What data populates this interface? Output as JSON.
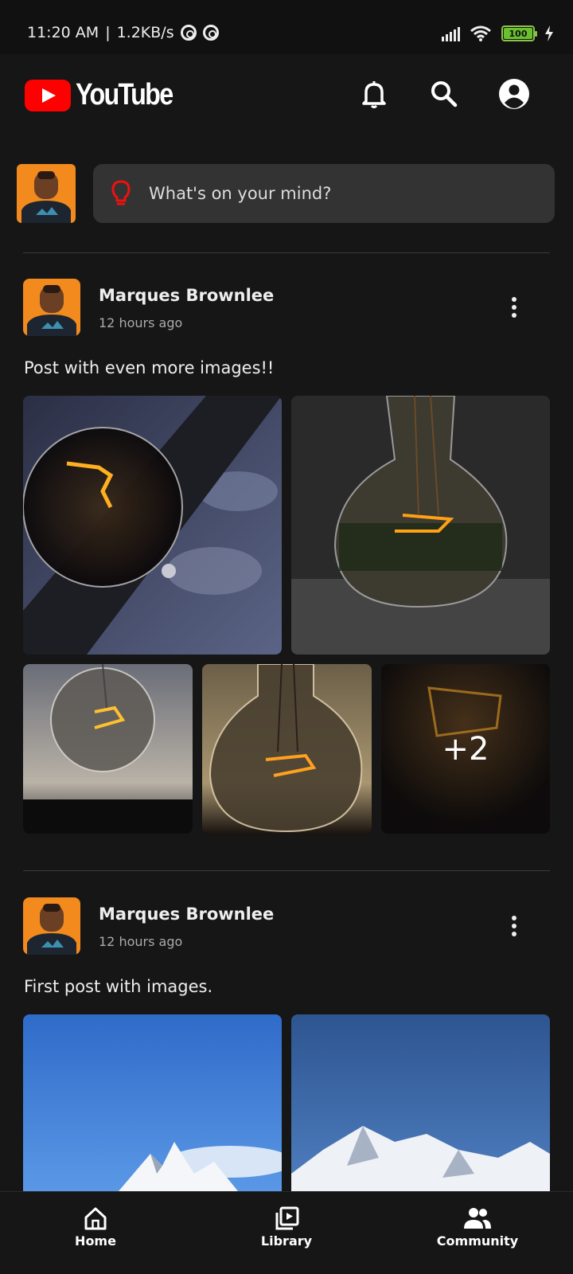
{
  "status_bar": {
    "time": "11:20 AM",
    "separator": "|",
    "network_speed": "1.2KB/s",
    "battery_level": "100"
  },
  "header": {
    "logo_text": "YouTube",
    "icons": [
      "bell-icon",
      "search-icon",
      "account-icon"
    ]
  },
  "composer": {
    "placeholder": "What's on your mind?",
    "icon": "lightbulb-icon"
  },
  "posts": [
    {
      "author": "Marques Brownlee",
      "time": "12 hours ago",
      "text": "Post with even more images!!",
      "more_images_label": "+2"
    },
    {
      "author": "Marques Brownlee",
      "time": "12 hours ago",
      "text": "First post with images."
    }
  ],
  "bottom_nav": {
    "items": [
      {
        "label": "Home",
        "icon": "home-icon"
      },
      {
        "label": "Library",
        "icon": "library-icon"
      },
      {
        "label": "Community",
        "icon": "community-icon"
      }
    ]
  },
  "colors": {
    "background": "#161616",
    "brand_red": "#ff0000",
    "composer_bg": "#333333"
  }
}
